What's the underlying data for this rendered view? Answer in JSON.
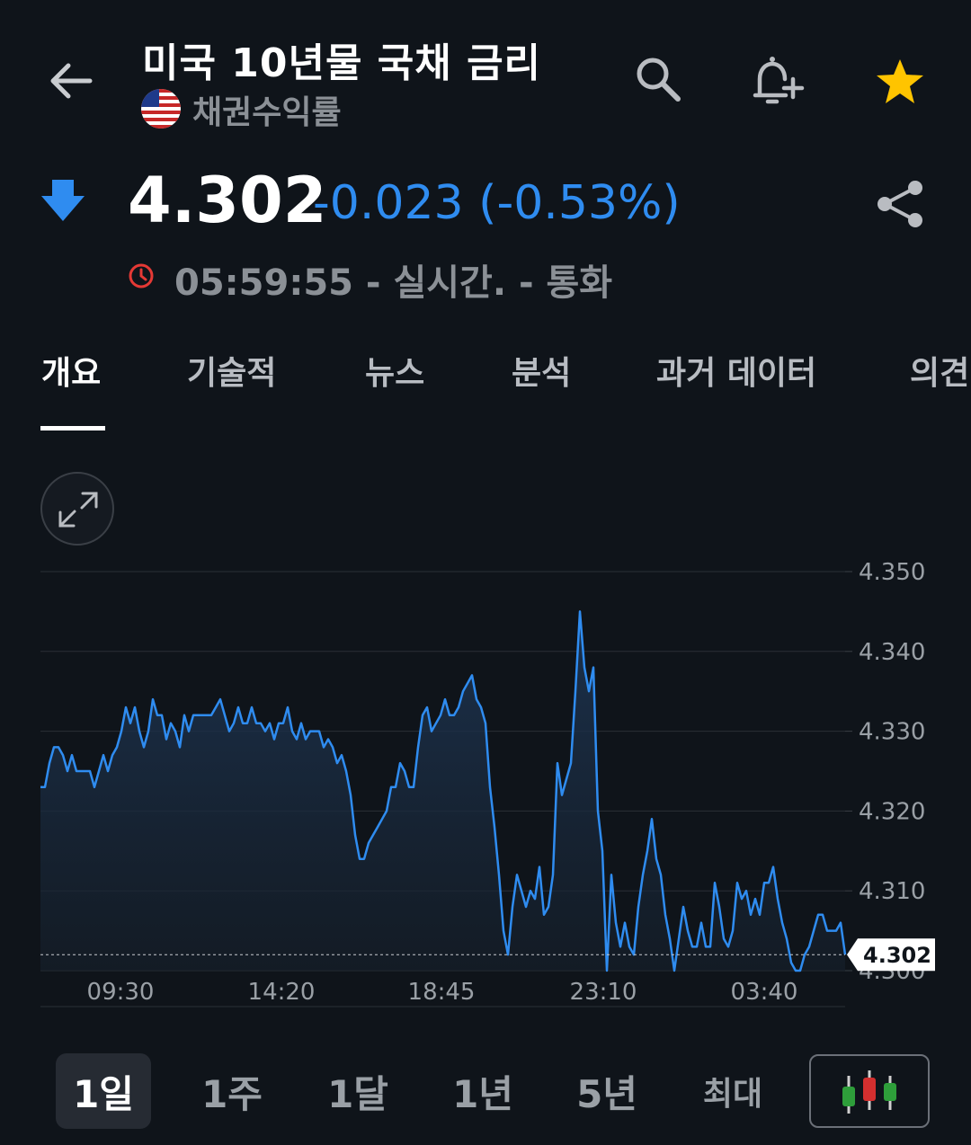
{
  "header": {
    "title": "미국 10년물 국채 금리",
    "subtitle": "채권수익률",
    "icons": [
      "arrow-left-icon",
      "search-icon",
      "add-alert-icon",
      "star-icon"
    ]
  },
  "quote": {
    "price": "4.302",
    "change": "-0.023 (-0.53%)",
    "time_status": "05:59:55 - 실시간. - 통화",
    "direction": "down",
    "colors": {
      "negative": "#2f8cf0",
      "star": "#ffc400",
      "clock": "#e53935"
    }
  },
  "tabs": [
    "개요",
    "기술적",
    "뉴스",
    "분석",
    "과거 데이터",
    "의견"
  ],
  "active_tab": "개요",
  "range_buttons": [
    "1일",
    "1주",
    "1달",
    "1년",
    "5년",
    "최대"
  ],
  "active_range": "1일",
  "chart_data": {
    "type": "area",
    "title": "",
    "xlabel": "",
    "ylabel": "",
    "x_ticks": [
      "09:30",
      "14:20",
      "18:45",
      "23:10",
      "03:40"
    ],
    "y_ticks": [
      "4.350",
      "4.340",
      "4.330",
      "4.320",
      "4.310",
      "4.300"
    ],
    "ylim": [
      4.3,
      4.35
    ],
    "last_value_label": "4.302",
    "line_color": "#2f8cf0",
    "grid": true,
    "series": [
      {
        "values": [
          4.323,
          4.323,
          4.326,
          4.328,
          4.328,
          4.327,
          4.325,
          4.327,
          4.325,
          4.325,
          4.325,
          4.325,
          4.323,
          4.325,
          4.327,
          4.325,
          4.327,
          4.328,
          4.33,
          4.333,
          4.331,
          4.333,
          4.33,
          4.328,
          4.33,
          4.334,
          4.332,
          4.332,
          4.329,
          4.331,
          4.33,
          4.328,
          4.332,
          4.33,
          4.332,
          4.332,
          4.332,
          4.332,
          4.332,
          4.333,
          4.334,
          4.332,
          4.33,
          4.331,
          4.333,
          4.331,
          4.331,
          4.333,
          4.331,
          4.331,
          4.33,
          4.331,
          4.329,
          4.331,
          4.331,
          4.333,
          4.33,
          4.329,
          4.331,
          4.329,
          4.33,
          4.33,
          4.33,
          4.328,
          4.329,
          4.328,
          4.326,
          4.327,
          4.325,
          4.322,
          4.317,
          4.314,
          4.314,
          4.316,
          4.317,
          4.318,
          4.319,
          4.32,
          4.323,
          4.323,
          4.326,
          4.325,
          4.323,
          4.323,
          4.328,
          4.332,
          4.333,
          4.33,
          4.331,
          4.332,
          4.334,
          4.332,
          4.332,
          4.333,
          4.335,
          4.336,
          4.337,
          4.334,
          4.333,
          4.331,
          4.323,
          4.318,
          4.312,
          4.305,
          4.302,
          4.308,
          4.312,
          4.31,
          4.308,
          4.31,
          4.309,
          4.313,
          4.307,
          4.308,
          4.312,
          4.326,
          4.322,
          4.324,
          4.326,
          4.335,
          4.345,
          4.338,
          4.335,
          4.338,
          4.32,
          4.315,
          4.3,
          4.312,
          4.306,
          4.303,
          4.306,
          4.303,
          4.302,
          4.308,
          4.312,
          4.315,
          4.319,
          4.314,
          4.312,
          4.307,
          4.304,
          4.3,
          4.304,
          4.308,
          4.305,
          4.303,
          4.303,
          4.306,
          4.303,
          4.303,
          4.311,
          4.308,
          4.304,
          4.303,
          4.305,
          4.311,
          4.309,
          4.31,
          4.307,
          4.309,
          4.307,
          4.311,
          4.311,
          4.313,
          4.309,
          4.306,
          4.304,
          4.301,
          4.3,
          4.3,
          4.302,
          4.303,
          4.305,
          4.307,
          4.307,
          4.305,
          4.305,
          4.305,
          4.306,
          4.302
        ]
      }
    ]
  }
}
